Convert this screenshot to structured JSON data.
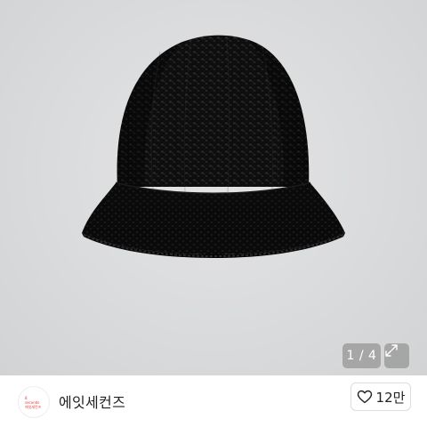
{
  "gallery": {
    "counter": "1 / 4",
    "expand_icon": "expand-icon"
  },
  "seller": {
    "avatar_logo": "8 seconds 에잇세컨즈",
    "name": "에잇세컨즈"
  },
  "like": {
    "icon": "heart-icon",
    "count": "12만"
  }
}
